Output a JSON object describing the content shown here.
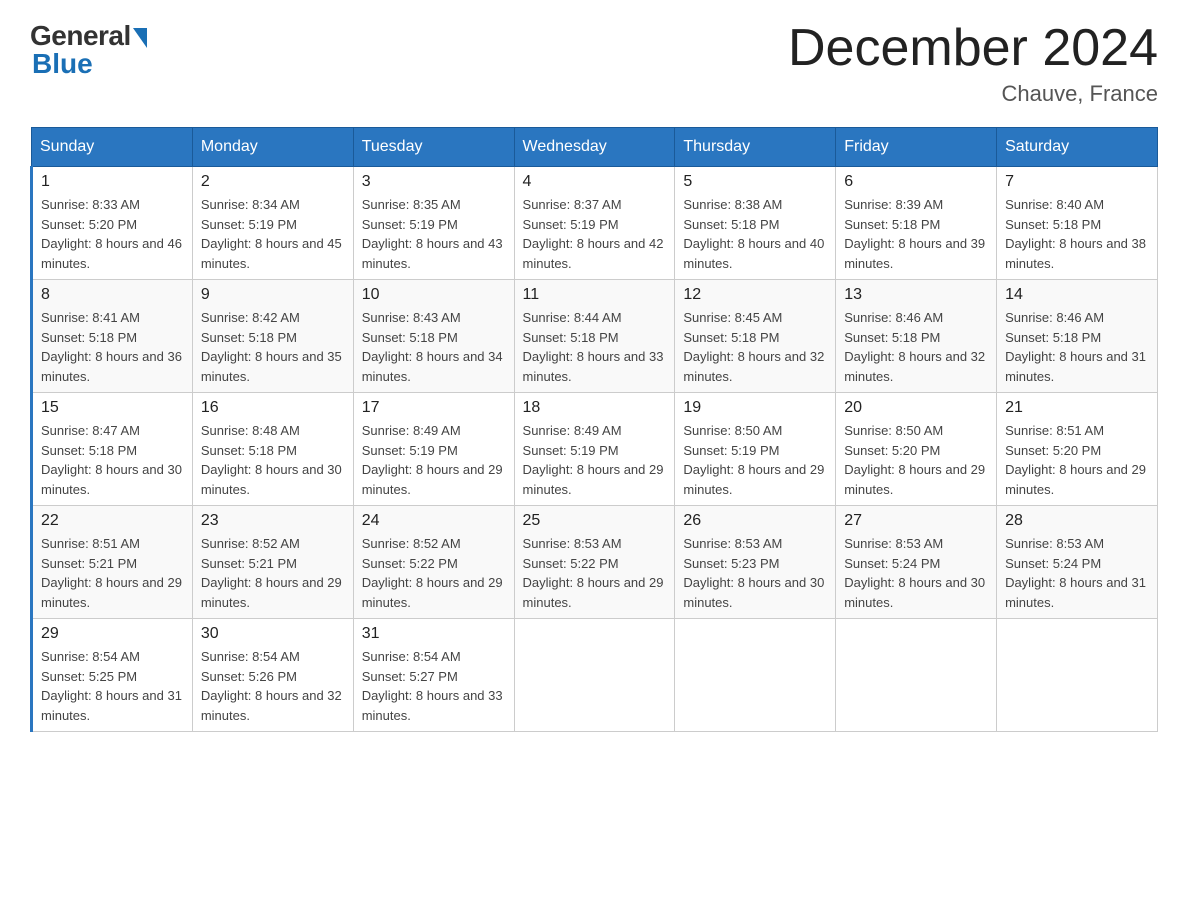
{
  "logo": {
    "general": "General",
    "blue": "Blue"
  },
  "title": "December 2024",
  "location": "Chauve, France",
  "days_of_week": [
    "Sunday",
    "Monday",
    "Tuesday",
    "Wednesday",
    "Thursday",
    "Friday",
    "Saturday"
  ],
  "weeks": [
    [
      {
        "num": "1",
        "sunrise": "8:33 AM",
        "sunset": "5:20 PM",
        "daylight": "8 hours and 46 minutes."
      },
      {
        "num": "2",
        "sunrise": "8:34 AM",
        "sunset": "5:19 PM",
        "daylight": "8 hours and 45 minutes."
      },
      {
        "num": "3",
        "sunrise": "8:35 AM",
        "sunset": "5:19 PM",
        "daylight": "8 hours and 43 minutes."
      },
      {
        "num": "4",
        "sunrise": "8:37 AM",
        "sunset": "5:19 PM",
        "daylight": "8 hours and 42 minutes."
      },
      {
        "num": "5",
        "sunrise": "8:38 AM",
        "sunset": "5:18 PM",
        "daylight": "8 hours and 40 minutes."
      },
      {
        "num": "6",
        "sunrise": "8:39 AM",
        "sunset": "5:18 PM",
        "daylight": "8 hours and 39 minutes."
      },
      {
        "num": "7",
        "sunrise": "8:40 AM",
        "sunset": "5:18 PM",
        "daylight": "8 hours and 38 minutes."
      }
    ],
    [
      {
        "num": "8",
        "sunrise": "8:41 AM",
        "sunset": "5:18 PM",
        "daylight": "8 hours and 36 minutes."
      },
      {
        "num": "9",
        "sunrise": "8:42 AM",
        "sunset": "5:18 PM",
        "daylight": "8 hours and 35 minutes."
      },
      {
        "num": "10",
        "sunrise": "8:43 AM",
        "sunset": "5:18 PM",
        "daylight": "8 hours and 34 minutes."
      },
      {
        "num": "11",
        "sunrise": "8:44 AM",
        "sunset": "5:18 PM",
        "daylight": "8 hours and 33 minutes."
      },
      {
        "num": "12",
        "sunrise": "8:45 AM",
        "sunset": "5:18 PM",
        "daylight": "8 hours and 32 minutes."
      },
      {
        "num": "13",
        "sunrise": "8:46 AM",
        "sunset": "5:18 PM",
        "daylight": "8 hours and 32 minutes."
      },
      {
        "num": "14",
        "sunrise": "8:46 AM",
        "sunset": "5:18 PM",
        "daylight": "8 hours and 31 minutes."
      }
    ],
    [
      {
        "num": "15",
        "sunrise": "8:47 AM",
        "sunset": "5:18 PM",
        "daylight": "8 hours and 30 minutes."
      },
      {
        "num": "16",
        "sunrise": "8:48 AM",
        "sunset": "5:18 PM",
        "daylight": "8 hours and 30 minutes."
      },
      {
        "num": "17",
        "sunrise": "8:49 AM",
        "sunset": "5:19 PM",
        "daylight": "8 hours and 29 minutes."
      },
      {
        "num": "18",
        "sunrise": "8:49 AM",
        "sunset": "5:19 PM",
        "daylight": "8 hours and 29 minutes."
      },
      {
        "num": "19",
        "sunrise": "8:50 AM",
        "sunset": "5:19 PM",
        "daylight": "8 hours and 29 minutes."
      },
      {
        "num": "20",
        "sunrise": "8:50 AM",
        "sunset": "5:20 PM",
        "daylight": "8 hours and 29 minutes."
      },
      {
        "num": "21",
        "sunrise": "8:51 AM",
        "sunset": "5:20 PM",
        "daylight": "8 hours and 29 minutes."
      }
    ],
    [
      {
        "num": "22",
        "sunrise": "8:51 AM",
        "sunset": "5:21 PM",
        "daylight": "8 hours and 29 minutes."
      },
      {
        "num": "23",
        "sunrise": "8:52 AM",
        "sunset": "5:21 PM",
        "daylight": "8 hours and 29 minutes."
      },
      {
        "num": "24",
        "sunrise": "8:52 AM",
        "sunset": "5:22 PM",
        "daylight": "8 hours and 29 minutes."
      },
      {
        "num": "25",
        "sunrise": "8:53 AM",
        "sunset": "5:22 PM",
        "daylight": "8 hours and 29 minutes."
      },
      {
        "num": "26",
        "sunrise": "8:53 AM",
        "sunset": "5:23 PM",
        "daylight": "8 hours and 30 minutes."
      },
      {
        "num": "27",
        "sunrise": "8:53 AM",
        "sunset": "5:24 PM",
        "daylight": "8 hours and 30 minutes."
      },
      {
        "num": "28",
        "sunrise": "8:53 AM",
        "sunset": "5:24 PM",
        "daylight": "8 hours and 31 minutes."
      }
    ],
    [
      {
        "num": "29",
        "sunrise": "8:54 AM",
        "sunset": "5:25 PM",
        "daylight": "8 hours and 31 minutes."
      },
      {
        "num": "30",
        "sunrise": "8:54 AM",
        "sunset": "5:26 PM",
        "daylight": "8 hours and 32 minutes."
      },
      {
        "num": "31",
        "sunrise": "8:54 AM",
        "sunset": "5:27 PM",
        "daylight": "8 hours and 33 minutes."
      },
      null,
      null,
      null,
      null
    ]
  ]
}
